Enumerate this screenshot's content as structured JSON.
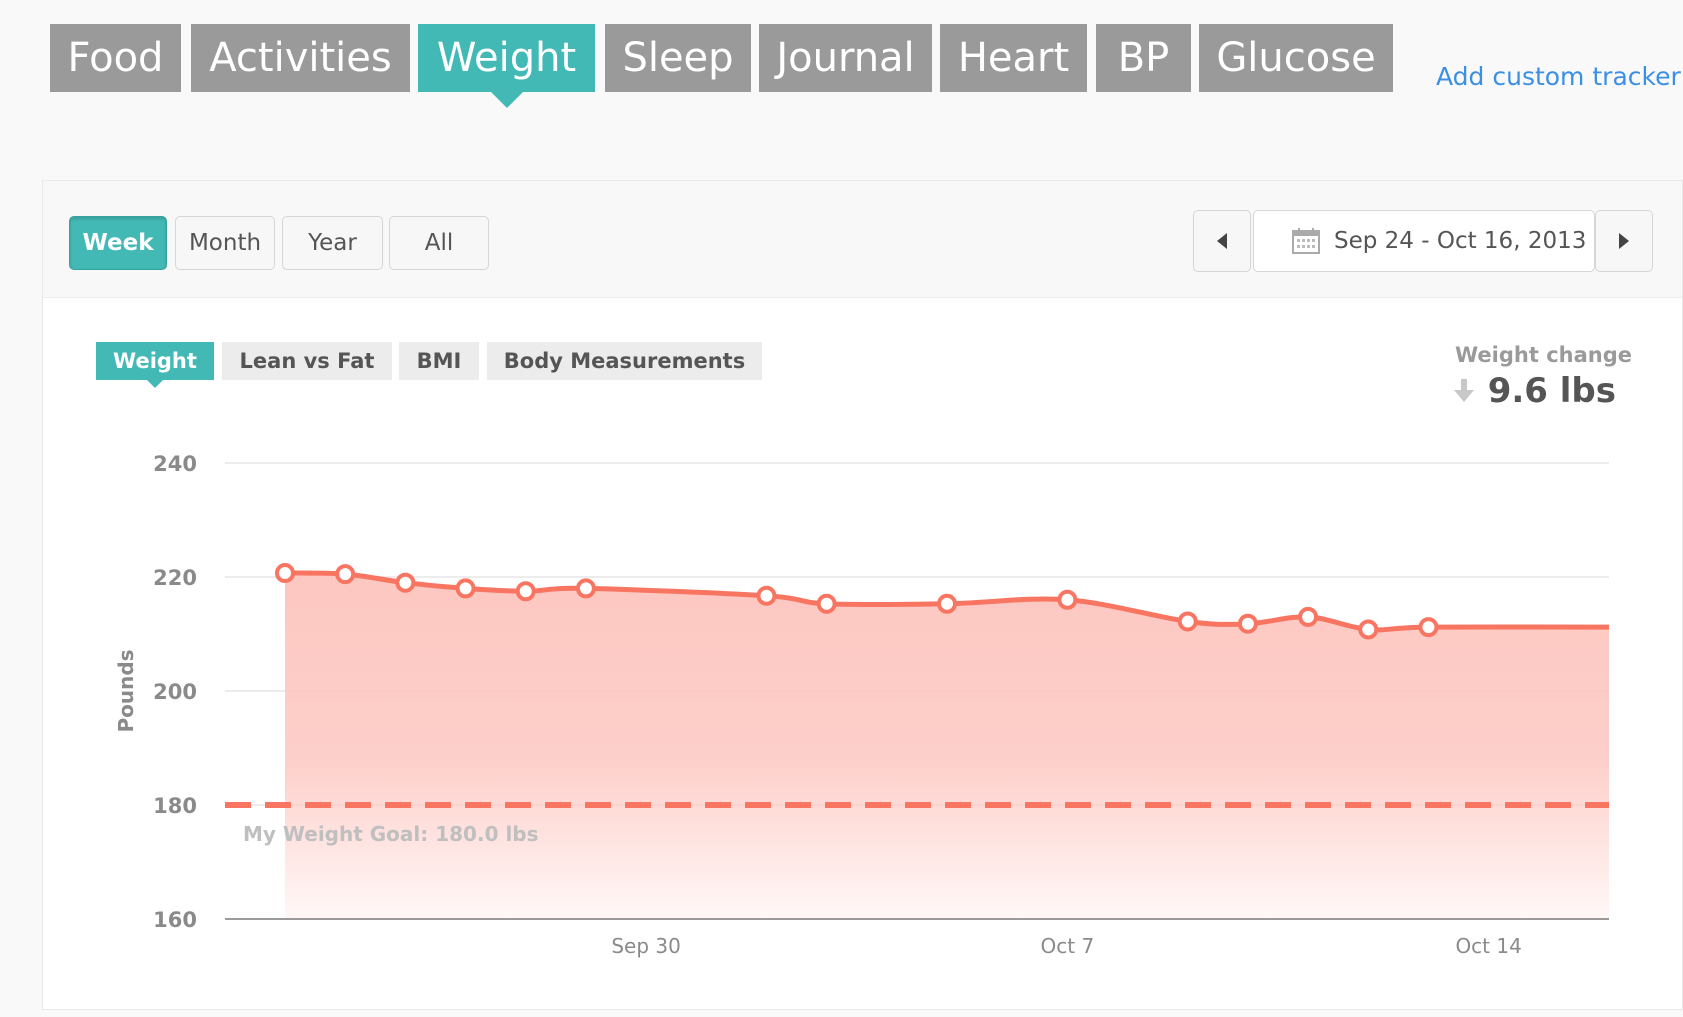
{
  "top_tabs": [
    {
      "label": "Food",
      "active": false
    },
    {
      "label": "Activities",
      "active": false
    },
    {
      "label": "Weight",
      "active": true
    },
    {
      "label": "Sleep",
      "active": false
    },
    {
      "label": "Journal",
      "active": false
    },
    {
      "label": "Heart",
      "active": false
    },
    {
      "label": "BP",
      "active": false
    },
    {
      "label": "Glucose",
      "active": false
    }
  ],
  "add_tracker_label": "Add custom tracker",
  "range_buttons": [
    {
      "label": "Week",
      "active": true
    },
    {
      "label": "Month",
      "active": false
    },
    {
      "label": "Year",
      "active": false
    },
    {
      "label": "All",
      "active": false
    }
  ],
  "date_range": "Sep 24 - Oct 16, 2013",
  "sub_tabs": [
    {
      "label": "Weight",
      "active": true
    },
    {
      "label": "Lean vs Fat",
      "active": false
    },
    {
      "label": "BMI",
      "active": false
    },
    {
      "label": "Body Measurements",
      "active": false
    }
  ],
  "weight_change": {
    "label": "Weight change",
    "value": "9.6 lbs",
    "direction": "down"
  },
  "colors": {
    "accent": "#43b9b5",
    "tab_inactive": "#9a9a9a",
    "line": "#f87562",
    "area": "#fdc7c1",
    "link": "#3b8fe4"
  },
  "chart_data": {
    "type": "area",
    "ylabel": "Pounds",
    "ylim": [
      160,
      240
    ],
    "yticks": [
      160,
      180,
      200,
      220,
      240
    ],
    "xticks": [
      {
        "label": "Sep 30",
        "date": "2013-09-30"
      },
      {
        "label": "Oct 7",
        "date": "2013-10-07"
      },
      {
        "label": "Oct 14",
        "date": "2013-10-14"
      }
    ],
    "xlim": [
      "2013-09-24",
      "2013-10-16"
    ],
    "series": [
      {
        "points": [
          {
            "x": "2013-09-24",
            "y": 220.7
          },
          {
            "x": "2013-09-25",
            "y": 220.5
          },
          {
            "x": "2013-09-26",
            "y": 219.0
          },
          {
            "x": "2013-09-27",
            "y": 218.0
          },
          {
            "x": "2013-09-28",
            "y": 217.5
          },
          {
            "x": "2013-09-29",
            "y": 218.0
          },
          {
            "x": "2013-10-02",
            "y": 216.7
          },
          {
            "x": "2013-10-03",
            "y": 215.3
          },
          {
            "x": "2013-10-05",
            "y": 215.3
          },
          {
            "x": "2013-10-07",
            "y": 216.0
          },
          {
            "x": "2013-10-09",
            "y": 212.2
          },
          {
            "x": "2013-10-10",
            "y": 211.8
          },
          {
            "x": "2013-10-11",
            "y": 213.0
          },
          {
            "x": "2013-10-12",
            "y": 210.8
          },
          {
            "x": "2013-10-13",
            "y": 211.2
          }
        ],
        "end": {
          "x": "2013-10-16",
          "y": 211.2
        }
      }
    ],
    "goal": {
      "value": 180.0,
      "label": "My Weight Goal: 180.0 lbs"
    },
    "grid": true
  }
}
